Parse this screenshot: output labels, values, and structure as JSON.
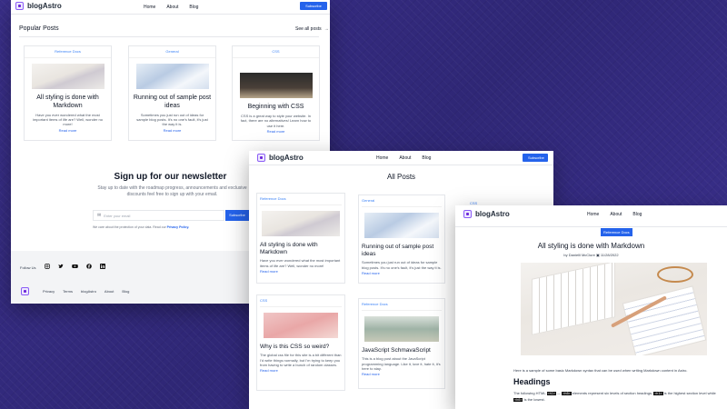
{
  "brand": "blogAstro",
  "nav": {
    "home": "Home",
    "about": "About",
    "blog": "Blog"
  },
  "subscribe_label": "Subscribe",
  "home": {
    "section_title": "Popular Posts",
    "see_all": "See all posts",
    "posts": [
      {
        "tag": "Reference Docs",
        "title": "All styling is done with Markdown",
        "desc": "Have you ever wondered what the most important items of life are? Well, wonder no more!",
        "read_more": "Read more"
      },
      {
        "tag": "General",
        "title": "Running out of sample post ideas",
        "desc": "Sometimes you just run out of ideas for sample blog posts. It's no one's fault, it's just the way it is.",
        "read_more": "Read more"
      },
      {
        "tag": "CSS",
        "title": "Beginning with CSS",
        "desc": "CSS is a great way to style your website. In fact, there are no alternatives! Learn how to use it here.",
        "read_more": "Read more"
      }
    ],
    "newsletter": {
      "title": "Sign up for our newsletter",
      "desc": "Stay up to date with the roadmap progress, announcements and exclusive discounts feel free to sign up with your email.",
      "placeholder": "Enter your email",
      "button": "Subscribe",
      "privacy": "We care about the protection of your data. Read our",
      "privacy_link": "Privacy Policy."
    },
    "follow_us": "Follow Us",
    "social_icons": [
      "instagram-icon",
      "twitter-icon",
      "youtube-icon",
      "facebook-icon",
      "linkedin-icon"
    ],
    "footer_links": {
      "privacy": "Privacy",
      "terms": "Terms",
      "blogastro": "blogAstro",
      "about": "About",
      "blog": "Blog"
    }
  },
  "all_posts": {
    "heading": "All Posts",
    "posts": [
      {
        "tag": "Reference Docs",
        "title": "All styling is done with Markdown",
        "desc": "Have you ever wondered what the most important items of life are? Well, wonder no more!",
        "read_more": "Read more"
      },
      {
        "tag": "General",
        "title": "Running out of sample post ideas",
        "desc": "Sometimes you just run out of ideas for sample blog posts. It's no one's fault, it's just the way it is.",
        "read_more": "Read more"
      },
      {
        "tag": "CSS",
        "title": "Why is this CSS so weird?",
        "desc": "The global css file for this site is a bit different than I'd write things normally, but I'm trying to keep you from having to write a bunch of random classes.",
        "read_more": "Read more"
      },
      {
        "tag": "Reference Docs",
        "title": "JavaScript SchmavaScript",
        "desc": "This is a blog post about the JavaScript programming language. Like it, love it, hate it, it's here to stay.",
        "read_more": "Read more"
      }
    ],
    "partial_tag": "CSS"
  },
  "article": {
    "tag": "Reference Docs",
    "title": "All styling is done with Markdown",
    "byline": "by Danielll McClure",
    "date": "11/28/2022",
    "intro": "Here is a sample of some basic Markdown syntax that can be used when writing Markdown content in Astro.",
    "headings_title": "Headings",
    "p1": "The following HTML",
    "code1": "<h1>",
    "dash": "—",
    "code2": "<h6>",
    "p2": "elements represent six levels of section headings.",
    "code3": "<h1>",
    "p3": "is the highest section level while",
    "code4": "<h6>",
    "p4": "is the lowest."
  },
  "colors": {
    "accent": "#2563eb",
    "background": "#3b2f86",
    "link": "#2563eb"
  }
}
